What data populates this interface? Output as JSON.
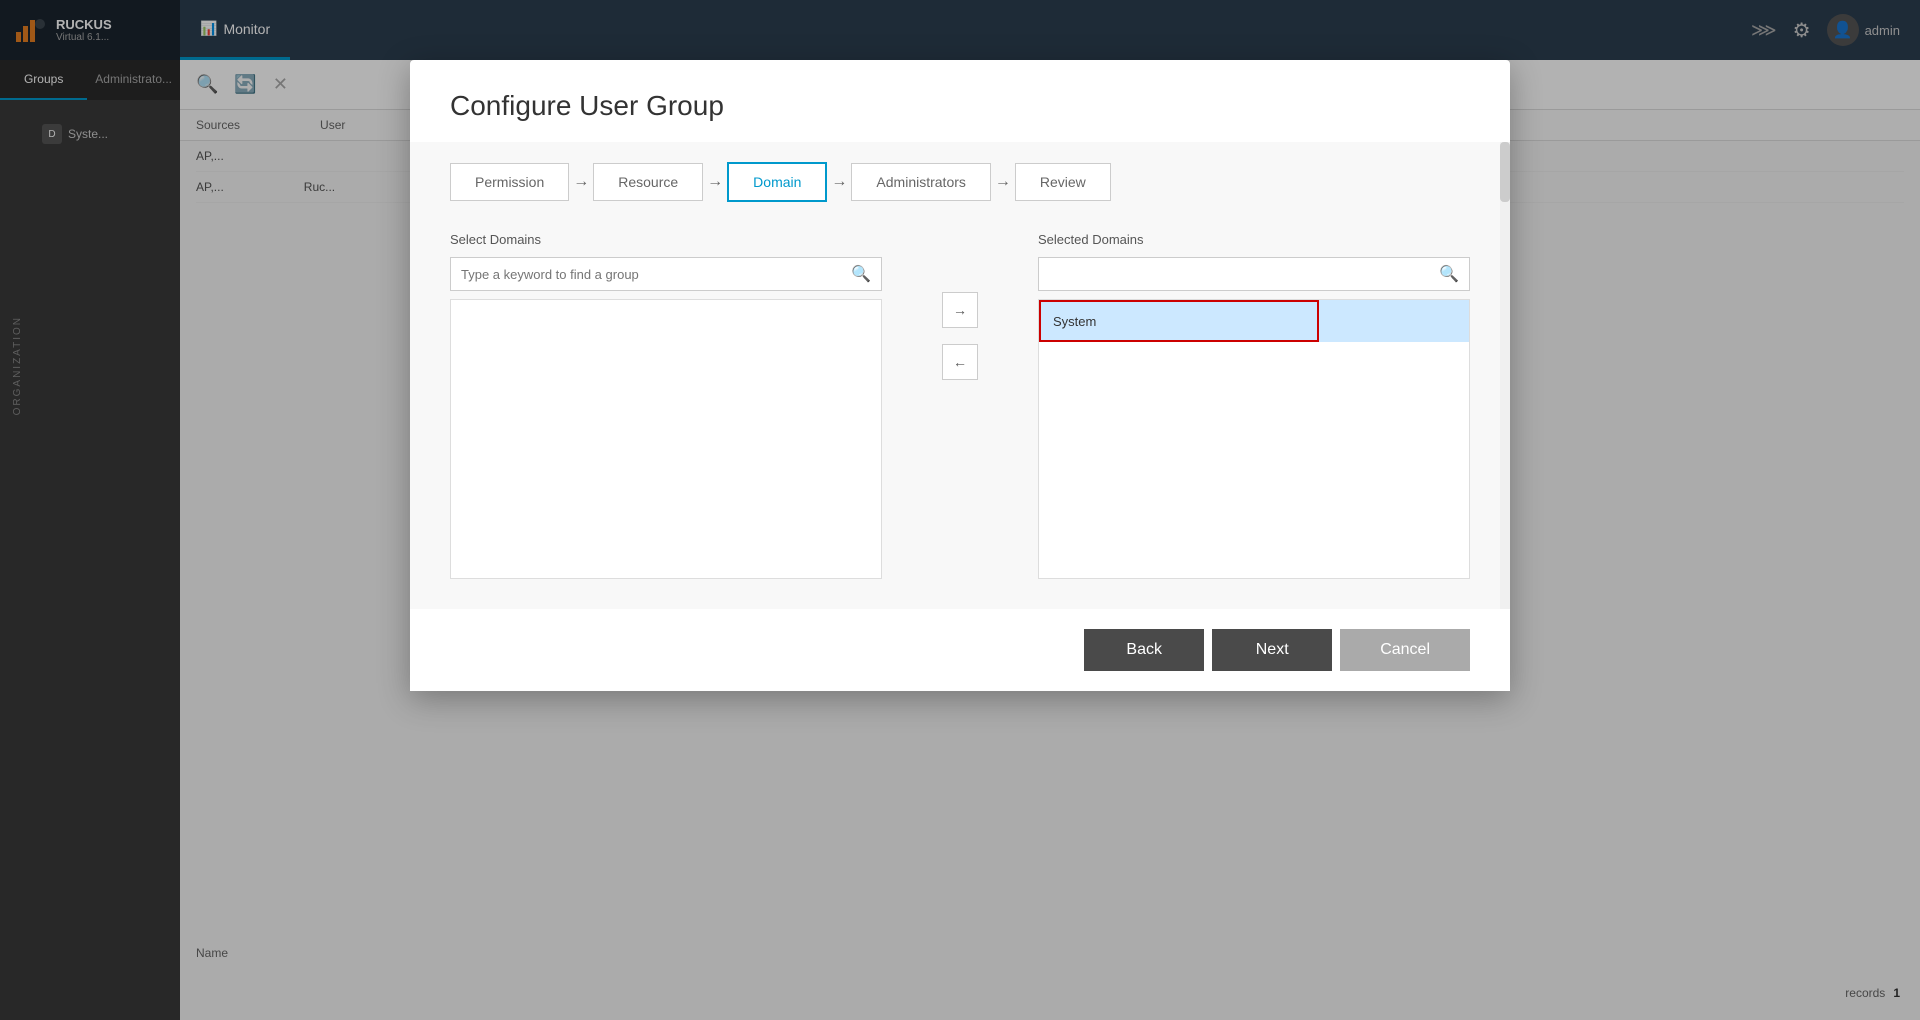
{
  "app": {
    "title": "Ruckus",
    "subtitle": "Virtual\n6.1...",
    "nav": {
      "items": [
        {
          "label": "Monitor",
          "active": true
        }
      ],
      "admin_label": "admin"
    }
  },
  "sidebar": {
    "tabs": [
      {
        "label": "Groups",
        "active": true
      },
      {
        "label": "Administrato...",
        "active": false
      }
    ],
    "org_label": "ORGANIZATION",
    "items": [
      {
        "badge": "D",
        "label": "Syste..."
      }
    ]
  },
  "right_table": {
    "col1": "Sources",
    "col2": "User",
    "row1_col1": "AP,...",
    "row1_col2": "",
    "row2_col1": "AP,...",
    "row2_col2": "Ruc...",
    "name_col": "Name",
    "pagination": {
      "records_label": "records",
      "page": "1"
    }
  },
  "dialog": {
    "title": "Configure User Group",
    "wizard": {
      "steps": [
        {
          "label": "Permission",
          "active": false
        },
        {
          "label": "Resource",
          "active": false
        },
        {
          "label": "Domain",
          "active": true
        },
        {
          "label": "Administrators",
          "active": false
        },
        {
          "label": "Review",
          "active": false
        }
      ]
    },
    "select_domains": {
      "title": "Select Domains",
      "search_placeholder": "Type a keyword to find a group",
      "items": []
    },
    "selected_domains": {
      "title": "Selected Domains",
      "search_placeholder": "",
      "items": [
        {
          "label": "System",
          "highlighted": true,
          "bordered": true
        }
      ]
    },
    "transfer_add_label": "→",
    "transfer_remove_label": "←",
    "buttons": {
      "back": "Back",
      "next": "Next",
      "cancel": "Cancel"
    }
  }
}
